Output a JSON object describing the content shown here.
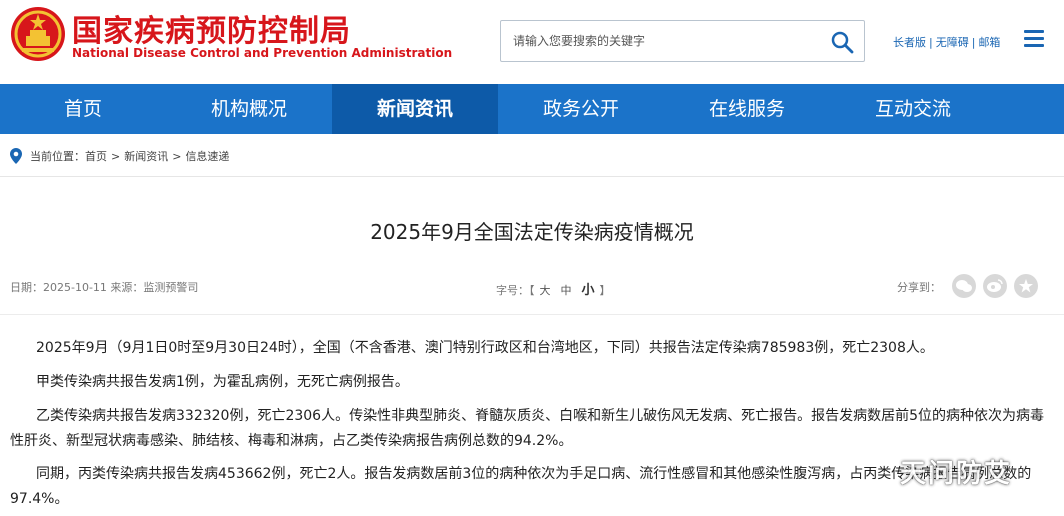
{
  "header": {
    "logo_cn": "国家疾病预防控制局",
    "logo_en": "National Disease Control and Prevention Administration",
    "search_placeholder": "请输入您要搜索的关键字",
    "links": [
      "长者版",
      "无障碍",
      "邮箱"
    ],
    "link_sep": "|"
  },
  "nav": {
    "items": [
      "首页",
      "机构概况",
      "新闻资讯",
      "政务公开",
      "在线服务",
      "互动交流"
    ],
    "active": "新闻资讯"
  },
  "breadcrumb": {
    "label": "当前位置：",
    "items": [
      "首页",
      "新闻资讯",
      "信息速递"
    ],
    "sep": ">"
  },
  "article": {
    "title": "2025年9月全国法定传染病疫情概况",
    "meta": "日期：2025-10-11 来源：监测预警司",
    "fontsize_label": "字号：",
    "bracket_open": "【",
    "bracket_close": "】",
    "fontsize_options": [
      "大",
      "中",
      "小"
    ],
    "share_label": "分享到：",
    "share_icons": [
      "wechat-icon",
      "weibo-icon",
      "star-icon"
    ],
    "paragraphs": [
      "2025年9月（9月1日0时至9月30日24时），全国（不含香港、澳门特别行政区和台湾地区，下同）共报告法定传染病785983例，死亡2308人。",
      "甲类传染病共报告发病1例，为霍乱病例，无死亡病例报告。",
      "乙类传染病共报告发病332320例，死亡2306人。传染性非典型肺炎、脊髓灰质炎、白喉和新生儿破伤风无发病、死亡报告。报告发病数居前5位的病种依次为病毒性肝炎、新型冠状病毒感染、肺结核、梅毒和淋病，占乙类传染病报告病例总数的94.2%。",
      "同期，丙类传染病共报告发病453662例，死亡2人。报告发病数居前3位的病种依次为手足口病、流行性感冒和其他感染性腹泻病，占丙类传染病报告病例总数的97.4%。"
    ]
  },
  "watermark": "天问防艾",
  "colors": {
    "brand_red": "#d7161b",
    "nav_blue": "#1b73c9",
    "nav_active": "#0d5aa8",
    "link_blue": "#1a66b3"
  }
}
